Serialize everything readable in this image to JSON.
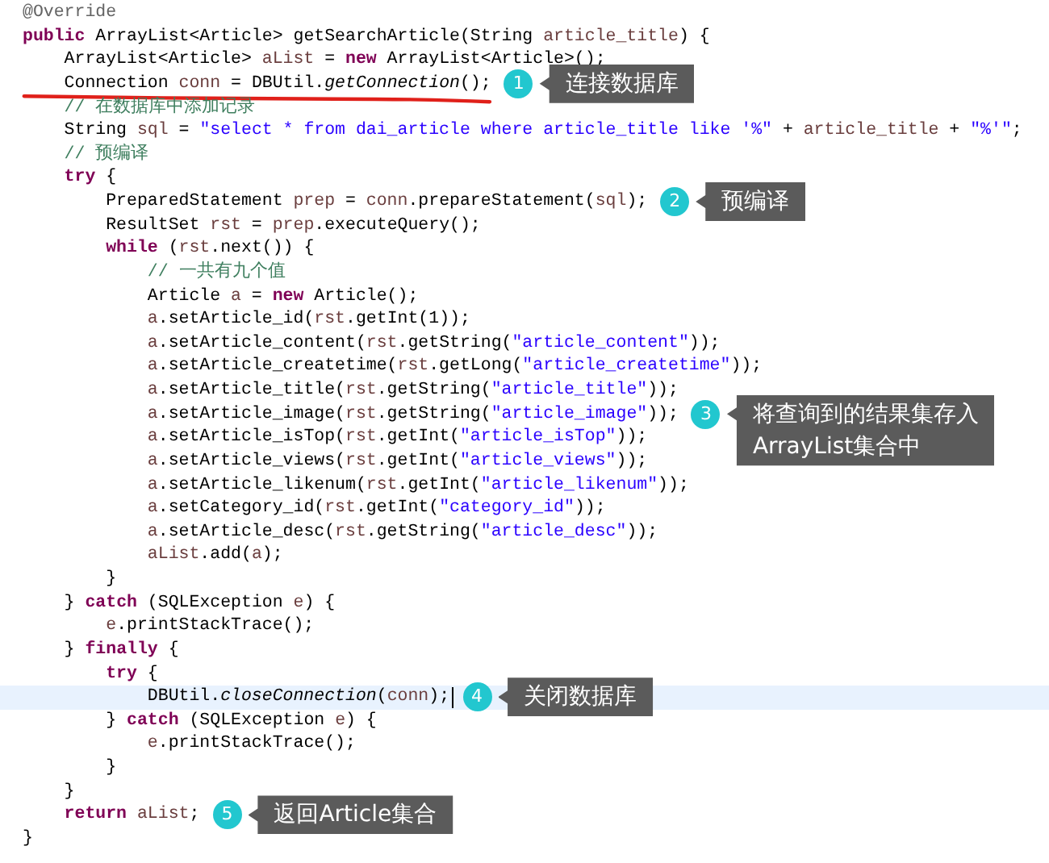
{
  "code_lines": [
    {
      "current": false,
      "underlined": false,
      "tokens": [
        {
          "kind": "annotation",
          "text": "@Override"
        }
      ]
    },
    {
      "current": false,
      "underlined": false,
      "tokens": [
        {
          "kind": "keyword",
          "text": "public"
        },
        {
          "kind": "plain",
          "text": " ArrayList<Article> getSearchArticle(String "
        },
        {
          "kind": "local",
          "text": "article_title"
        },
        {
          "kind": "plain",
          "text": ") {"
        }
      ]
    },
    {
      "current": false,
      "underlined": false,
      "tokens": [
        {
          "kind": "plain",
          "text": "    ArrayList<Article> "
        },
        {
          "kind": "local",
          "text": "aList"
        },
        {
          "kind": "plain",
          "text": " = "
        },
        {
          "kind": "keyword",
          "text": "new"
        },
        {
          "kind": "plain",
          "text": " ArrayList<Article>();"
        }
      ]
    },
    {
      "current": false,
      "underlined": true,
      "tokens": [
        {
          "kind": "plain",
          "text": "    Connection "
        },
        {
          "kind": "local",
          "text": "conn"
        },
        {
          "kind": "plain",
          "text": " = DBUtil."
        },
        {
          "kind": "static",
          "text": "getConnection"
        },
        {
          "kind": "plain",
          "text": "();"
        }
      ],
      "callout": {
        "number": "1",
        "text": "连接数据库"
      }
    },
    {
      "current": false,
      "underlined": false,
      "tokens": [
        {
          "kind": "comment",
          "text": "    // 在数据库中添加记录"
        }
      ]
    },
    {
      "current": false,
      "underlined": false,
      "tokens": [
        {
          "kind": "plain",
          "text": "    String "
        },
        {
          "kind": "local",
          "text": "sql"
        },
        {
          "kind": "plain",
          "text": " = "
        },
        {
          "kind": "string",
          "text": "\"select * from dai_article where article_title like '%\""
        },
        {
          "kind": "plain",
          "text": " + "
        },
        {
          "kind": "local",
          "text": "article_title"
        },
        {
          "kind": "plain",
          "text": " + "
        },
        {
          "kind": "string",
          "text": "\"%'\""
        },
        {
          "kind": "plain",
          "text": ";"
        }
      ]
    },
    {
      "current": false,
      "underlined": false,
      "tokens": [
        {
          "kind": "comment",
          "text": "    // 预编译"
        }
      ]
    },
    {
      "current": false,
      "underlined": false,
      "tokens": [
        {
          "kind": "keyword",
          "text": "    try"
        },
        {
          "kind": "plain",
          "text": " {"
        }
      ]
    },
    {
      "current": false,
      "underlined": false,
      "tokens": [
        {
          "kind": "plain",
          "text": "        PreparedStatement "
        },
        {
          "kind": "local",
          "text": "prep"
        },
        {
          "kind": "plain",
          "text": " = "
        },
        {
          "kind": "local",
          "text": "conn"
        },
        {
          "kind": "plain",
          "text": ".prepareStatement("
        },
        {
          "kind": "local",
          "text": "sql"
        },
        {
          "kind": "plain",
          "text": ");"
        }
      ],
      "callout": {
        "number": "2",
        "text": "预编译"
      }
    },
    {
      "current": false,
      "underlined": false,
      "tokens": [
        {
          "kind": "plain",
          "text": "        ResultSet "
        },
        {
          "kind": "local",
          "text": "rst"
        },
        {
          "kind": "plain",
          "text": " = "
        },
        {
          "kind": "local",
          "text": "prep"
        },
        {
          "kind": "plain",
          "text": ".executeQuery();"
        }
      ]
    },
    {
      "current": false,
      "underlined": false,
      "tokens": [
        {
          "kind": "keyword",
          "text": "        while"
        },
        {
          "kind": "plain",
          "text": " ("
        },
        {
          "kind": "local",
          "text": "rst"
        },
        {
          "kind": "plain",
          "text": ".next()) {"
        }
      ]
    },
    {
      "current": false,
      "underlined": false,
      "tokens": [
        {
          "kind": "comment",
          "text": "            // 一共有九个值"
        }
      ]
    },
    {
      "current": false,
      "underlined": false,
      "tokens": [
        {
          "kind": "plain",
          "text": "            Article "
        },
        {
          "kind": "local",
          "text": "a"
        },
        {
          "kind": "plain",
          "text": " = "
        },
        {
          "kind": "keyword",
          "text": "new"
        },
        {
          "kind": "plain",
          "text": " Article();"
        }
      ]
    },
    {
      "current": false,
      "underlined": false,
      "tokens": [
        {
          "kind": "local",
          "text": "            a"
        },
        {
          "kind": "plain",
          "text": ".setArticle_id("
        },
        {
          "kind": "local",
          "text": "rst"
        },
        {
          "kind": "plain",
          "text": ".getInt(1));"
        }
      ]
    },
    {
      "current": false,
      "underlined": false,
      "tokens": [
        {
          "kind": "local",
          "text": "            a"
        },
        {
          "kind": "plain",
          "text": ".setArticle_content("
        },
        {
          "kind": "local",
          "text": "rst"
        },
        {
          "kind": "plain",
          "text": ".getString("
        },
        {
          "kind": "string",
          "text": "\"article_content\""
        },
        {
          "kind": "plain",
          "text": "));"
        }
      ]
    },
    {
      "current": false,
      "underlined": false,
      "tokens": [
        {
          "kind": "local",
          "text": "            a"
        },
        {
          "kind": "plain",
          "text": ".setArticle_createtime("
        },
        {
          "kind": "local",
          "text": "rst"
        },
        {
          "kind": "plain",
          "text": ".getLong("
        },
        {
          "kind": "string",
          "text": "\"article_createtime\""
        },
        {
          "kind": "plain",
          "text": "));"
        }
      ]
    },
    {
      "current": false,
      "underlined": false,
      "tokens": [
        {
          "kind": "local",
          "text": "            a"
        },
        {
          "kind": "plain",
          "text": ".setArticle_title("
        },
        {
          "kind": "local",
          "text": "rst"
        },
        {
          "kind": "plain",
          "text": ".getString("
        },
        {
          "kind": "string",
          "text": "\"article_title\""
        },
        {
          "kind": "plain",
          "text": "));"
        }
      ]
    },
    {
      "current": false,
      "underlined": false,
      "tokens": [
        {
          "kind": "local",
          "text": "            a"
        },
        {
          "kind": "plain",
          "text": ".setArticle_image("
        },
        {
          "kind": "local",
          "text": "rst"
        },
        {
          "kind": "plain",
          "text": ".getString("
        },
        {
          "kind": "string",
          "text": "\"article_image\""
        },
        {
          "kind": "plain",
          "text": "));"
        }
      ],
      "callout": {
        "number": "3",
        "text": "将查询到的结果集存入\nArrayList集合中"
      }
    },
    {
      "current": false,
      "underlined": false,
      "tokens": [
        {
          "kind": "local",
          "text": "            a"
        },
        {
          "kind": "plain",
          "text": ".setArticle_isTop("
        },
        {
          "kind": "local",
          "text": "rst"
        },
        {
          "kind": "plain",
          "text": ".getInt("
        },
        {
          "kind": "string",
          "text": "\"article_isTop\""
        },
        {
          "kind": "plain",
          "text": "));"
        }
      ]
    },
    {
      "current": false,
      "underlined": false,
      "tokens": [
        {
          "kind": "local",
          "text": "            a"
        },
        {
          "kind": "plain",
          "text": ".setArticle_views("
        },
        {
          "kind": "local",
          "text": "rst"
        },
        {
          "kind": "plain",
          "text": ".getInt("
        },
        {
          "kind": "string",
          "text": "\"article_views\""
        },
        {
          "kind": "plain",
          "text": "));"
        }
      ]
    },
    {
      "current": false,
      "underlined": false,
      "tokens": [
        {
          "kind": "local",
          "text": "            a"
        },
        {
          "kind": "plain",
          "text": ".setArticle_likenum("
        },
        {
          "kind": "local",
          "text": "rst"
        },
        {
          "kind": "plain",
          "text": ".getInt("
        },
        {
          "kind": "string",
          "text": "\"article_likenum\""
        },
        {
          "kind": "plain",
          "text": "));"
        }
      ]
    },
    {
      "current": false,
      "underlined": false,
      "tokens": [
        {
          "kind": "local",
          "text": "            a"
        },
        {
          "kind": "plain",
          "text": ".setCategory_id("
        },
        {
          "kind": "local",
          "text": "rst"
        },
        {
          "kind": "plain",
          "text": ".getInt("
        },
        {
          "kind": "string",
          "text": "\"category_id\""
        },
        {
          "kind": "plain",
          "text": "));"
        }
      ]
    },
    {
      "current": false,
      "underlined": false,
      "tokens": [
        {
          "kind": "local",
          "text": "            a"
        },
        {
          "kind": "plain",
          "text": ".setArticle_desc("
        },
        {
          "kind": "local",
          "text": "rst"
        },
        {
          "kind": "plain",
          "text": ".getString("
        },
        {
          "kind": "string",
          "text": "\"article_desc\""
        },
        {
          "kind": "plain",
          "text": "));"
        }
      ]
    },
    {
      "current": false,
      "underlined": false,
      "tokens": [
        {
          "kind": "local",
          "text": "            aList"
        },
        {
          "kind": "plain",
          "text": ".add("
        },
        {
          "kind": "local",
          "text": "a"
        },
        {
          "kind": "plain",
          "text": ");"
        }
      ]
    },
    {
      "current": false,
      "underlined": false,
      "tokens": [
        {
          "kind": "plain",
          "text": "        }"
        }
      ]
    },
    {
      "current": false,
      "underlined": false,
      "tokens": [
        {
          "kind": "plain",
          "text": "    } "
        },
        {
          "kind": "keyword",
          "text": "catch"
        },
        {
          "kind": "plain",
          "text": " (SQLException "
        },
        {
          "kind": "local",
          "text": "e"
        },
        {
          "kind": "plain",
          "text": ") {"
        }
      ]
    },
    {
      "current": false,
      "underlined": false,
      "tokens": [
        {
          "kind": "local",
          "text": "        e"
        },
        {
          "kind": "plain",
          "text": ".printStackTrace();"
        }
      ]
    },
    {
      "current": false,
      "underlined": false,
      "tokens": [
        {
          "kind": "plain",
          "text": "    } "
        },
        {
          "kind": "keyword",
          "text": "finally"
        },
        {
          "kind": "plain",
          "text": " {"
        }
      ]
    },
    {
      "current": false,
      "underlined": false,
      "tokens": [
        {
          "kind": "keyword",
          "text": "        try"
        },
        {
          "kind": "plain",
          "text": " {"
        }
      ]
    },
    {
      "current": true,
      "underlined": false,
      "tokens": [
        {
          "kind": "plain",
          "text": "            DBUtil."
        },
        {
          "kind": "static",
          "text": "closeConnection"
        },
        {
          "kind": "plain",
          "text": "("
        },
        {
          "kind": "local",
          "text": "conn"
        },
        {
          "kind": "plain",
          "text": ");"
        }
      ],
      "callout": {
        "number": "4",
        "text": "关闭数据库"
      }
    },
    {
      "current": false,
      "underlined": false,
      "tokens": [
        {
          "kind": "plain",
          "text": "        } "
        },
        {
          "kind": "keyword",
          "text": "catch"
        },
        {
          "kind": "plain",
          "text": " (SQLException "
        },
        {
          "kind": "local",
          "text": "e"
        },
        {
          "kind": "plain",
          "text": ") {"
        }
      ]
    },
    {
      "current": false,
      "underlined": false,
      "tokens": [
        {
          "kind": "local",
          "text": "            e"
        },
        {
          "kind": "plain",
          "text": ".printStackTrace();"
        }
      ]
    },
    {
      "current": false,
      "underlined": false,
      "tokens": [
        {
          "kind": "plain",
          "text": "        }"
        }
      ]
    },
    {
      "current": false,
      "underlined": false,
      "tokens": [
        {
          "kind": "plain",
          "text": "    }"
        }
      ]
    },
    {
      "current": false,
      "underlined": false,
      "tokens": [
        {
          "kind": "keyword",
          "text": "    return"
        },
        {
          "kind": "local",
          "text": " aList"
        },
        {
          "kind": "plain",
          "text": ";"
        }
      ],
      "callout": {
        "number": "5",
        "text": "返回Article集合"
      }
    },
    {
      "current": false,
      "underlined": false,
      "tokens": [
        {
          "kind": "plain",
          "text": "}"
        }
      ]
    }
  ]
}
